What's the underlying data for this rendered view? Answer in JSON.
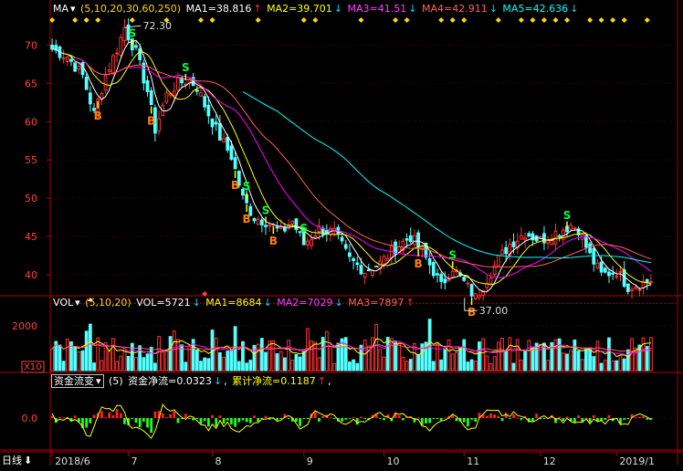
{
  "colors": {
    "bg": "#000000",
    "frame": "#b00000",
    "grid": "#5a0000",
    "up": "#ff3232",
    "down": "#54ffff",
    "axis_text": "#ff4040",
    "ma1": "#ffffff",
    "ma2": "#ffff00",
    "ma3": "#ff00ff",
    "ma4": "#ff6060",
    "ma5": "#00ffff",
    "signal_b": "#ff8000",
    "signal_s": "#00ff40"
  },
  "main_legend": {
    "indicator_btn": "MA",
    "params": "(5,10,20,30,60,250)",
    "ma1": "MA1=38.816",
    "ma2": "MA2=39.701",
    "ma3": "MA3=41.51",
    "ma4": "MA4=42.911",
    "ma5": "MA5=42.636"
  },
  "price_axis": {
    "ticks": [
      "70",
      "65",
      "60",
      "55",
      "50",
      "45",
      "40"
    ],
    "tick_values": [
      70,
      65,
      60,
      55,
      50,
      45,
      40
    ],
    "range": [
      37.5,
      73.5
    ]
  },
  "annotations": {
    "high_label": "72.30",
    "high_value": 72.3,
    "low_label": "37.00",
    "low_value": 37.0,
    "buy_letter": "B",
    "sell_letter": "S"
  },
  "vol_legend": {
    "indicator_btn": "VOL",
    "params": "(5,10,20)",
    "vol": "VOL=5721",
    "ma1": "MA1=8684",
    "ma2": "MA2=7029",
    "ma3": "MA3=7897"
  },
  "vol_axis": {
    "tick": "2000",
    "tick_value": 2000,
    "unit": "X10",
    "range": [
      0,
      2700
    ]
  },
  "flow_legend": {
    "indicator_btn": "资金流变",
    "params": "(5)",
    "net": "资金净流=0.0323",
    "cumulative": "累计净流=0.1187"
  },
  "flow_axis": {
    "tick": "0.0",
    "tick_value": 0.0,
    "range": [
      -0.3,
      0.3
    ]
  },
  "period_button": "日线",
  "date_axis": [
    "2018/6",
    "7",
    "8",
    "9",
    "10",
    "11",
    "12",
    "2019/1"
  ],
  "chart_data": {
    "type": "candlestick",
    "bar_count": 158,
    "price_anchors": [
      [
        0,
        69.5
      ],
      [
        4,
        68.5
      ],
      [
        8,
        66.0
      ],
      [
        11,
        61.0
      ],
      [
        14,
        66.0
      ],
      [
        17,
        69.5
      ],
      [
        19,
        72.3
      ],
      [
        22,
        69.0
      ],
      [
        25,
        64.0
      ],
      [
        27,
        59.0
      ],
      [
        30,
        63.5
      ],
      [
        33,
        65.0
      ],
      [
        36,
        65.5
      ],
      [
        38,
        64.5
      ],
      [
        41,
        61.0
      ],
      [
        44,
        58.0
      ],
      [
        47,
        55.5
      ],
      [
        50,
        50.0
      ],
      [
        53,
        47.5
      ],
      [
        56,
        47.0
      ],
      [
        60,
        45.5
      ],
      [
        63,
        47.0
      ],
      [
        66,
        44.0
      ],
      [
        70,
        46.0
      ],
      [
        74,
        45.5
      ],
      [
        78,
        42.0
      ],
      [
        82,
        40.5
      ],
      [
        86,
        41.5
      ],
      [
        90,
        43.5
      ],
      [
        94,
        45.0
      ],
      [
        97,
        43.0
      ],
      [
        100,
        40.5
      ],
      [
        102,
        38.5
      ],
      [
        105,
        41.0
      ],
      [
        108,
        39.0
      ],
      [
        111,
        37.0
      ],
      [
        114,
        39.5
      ],
      [
        117,
        42.0
      ],
      [
        120,
        44.0
      ],
      [
        124,
        45.5
      ],
      [
        128,
        44.5
      ],
      [
        132,
        45.5
      ],
      [
        136,
        46.5
      ],
      [
        138,
        46.0
      ],
      [
        141,
        42.5
      ],
      [
        144,
        40.0
      ],
      [
        148,
        40.5
      ],
      [
        151,
        38.5
      ],
      [
        154,
        38.8
      ],
      [
        157,
        39.3
      ]
    ],
    "signals": [
      {
        "type": "B",
        "bar": 12
      },
      {
        "type": "S",
        "bar": 21
      },
      {
        "type": "B",
        "bar": 26
      },
      {
        "type": "S",
        "bar": 35
      },
      {
        "type": "B",
        "bar": 48
      },
      {
        "type": "S",
        "bar": 51
      },
      {
        "type": "B",
        "bar": 51
      },
      {
        "type": "S",
        "bar": 56
      },
      {
        "type": "B",
        "bar": 58
      },
      {
        "type": "S",
        "bar": 66
      },
      {
        "type": "B",
        "bar": 96
      },
      {
        "type": "S",
        "bar": 105
      },
      {
        "type": "B",
        "bar": 110
      },
      {
        "type": "S",
        "bar": 135
      }
    ]
  }
}
